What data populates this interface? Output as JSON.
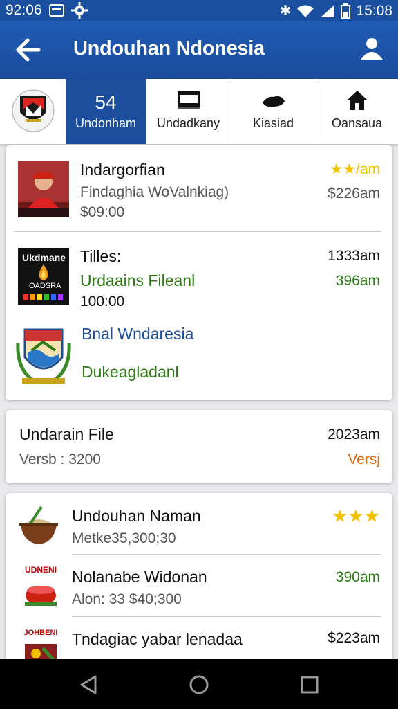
{
  "status_bar": {
    "time_left": "92:06",
    "time_right": "15:08"
  },
  "app_bar": {
    "title": "Undouhan Ndonesia"
  },
  "tabs": [
    {
      "count": "54",
      "label": "Undonham",
      "icon": "emblem-logo",
      "active": true
    },
    {
      "label": "Undadkany",
      "icon": "briefcase-icon"
    },
    {
      "label": "Kiasiad",
      "icon": "cloud-icon"
    },
    {
      "label": "Oansaua",
      "icon": "home-icon"
    }
  ],
  "card1": {
    "item1": {
      "title": "Indargorfian",
      "subtitle": "Findaghia WoValnkiag)",
      "price": "$09:00",
      "rating": "★★",
      "rating_suffix": "/am",
      "time": "$226am"
    },
    "item2": {
      "title": "Tilles:",
      "subtitle": "Urdaains Fileanl",
      "value": "100:00",
      "time1": "1333am",
      "time2": "396am",
      "thumb_text_top": "Ukdmane",
      "thumb_text_bottom": "OADSRA"
    },
    "item3": {
      "title": "Bnal Wndaresia",
      "subtitle": "Dukeagladanl"
    }
  },
  "card2": {
    "title": "Undarain File",
    "subtitle": "Versb : 3200",
    "time": "2023am",
    "badge": "Versj"
  },
  "card3": {
    "items": [
      {
        "title": "Undouhan Naman",
        "subtitle": "Metke35,300;30",
        "rating": "★★★"
      },
      {
        "title": "Nolanabe Widonan",
        "subtitle": "Alon: 33 $40;300",
        "time": "390am",
        "thumb_text": "UDNENI"
      },
      {
        "title": "Tndagiac yabar lenadaa",
        "time": "$223am",
        "thumb_text": "JOHBENI"
      }
    ]
  },
  "colors": {
    "primary": "#1b4f9e",
    "green": "#2b7a14",
    "orange": "#d9670f",
    "gold": "#f2c200"
  }
}
